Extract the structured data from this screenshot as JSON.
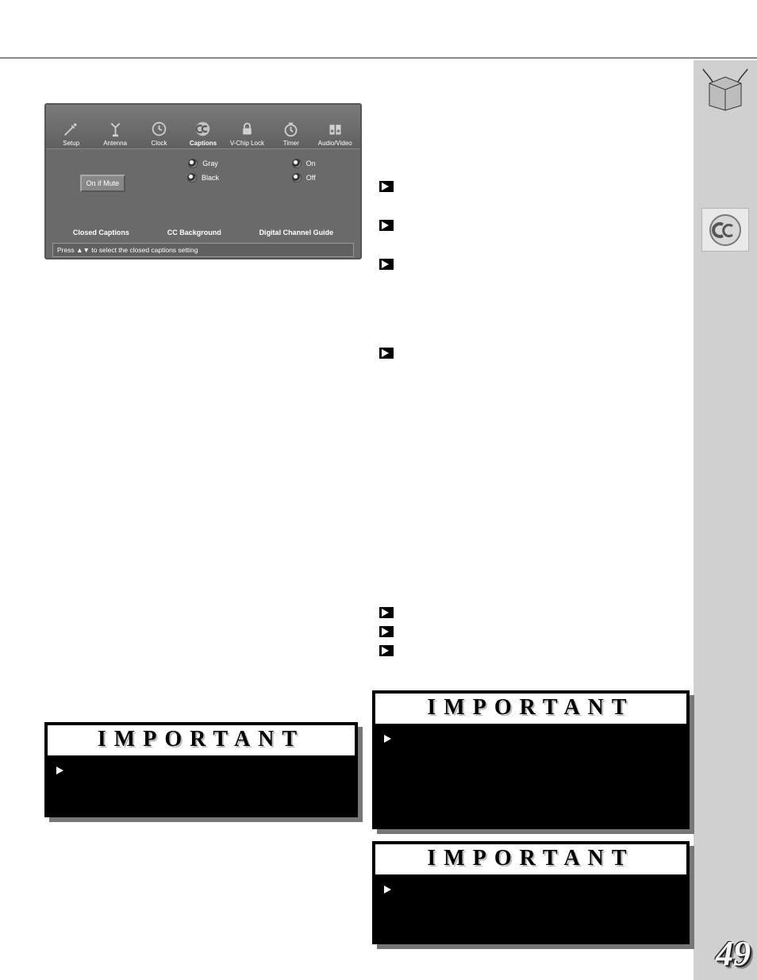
{
  "page_number": "49",
  "osd": {
    "tabs": [
      {
        "label": "Setup",
        "icon": "wand"
      },
      {
        "label": "Antenna",
        "icon": "antenna"
      },
      {
        "label": "Clock",
        "icon": "clock"
      },
      {
        "label": "Captions",
        "icon": "cc",
        "active": true
      },
      {
        "label": "V-Chip Lock",
        "icon": "lock"
      },
      {
        "label": "Timer",
        "icon": "timer"
      },
      {
        "label": "Audio/Video",
        "icon": "speakers"
      }
    ],
    "columns": {
      "closed_captions": {
        "label": "Closed Captions",
        "button": "On if Mute"
      },
      "cc_background": {
        "label": "CC Background",
        "opts": [
          "Gray",
          "Black"
        ]
      },
      "digital_channel_guide": {
        "label": "Digital Channel Guide",
        "opts": [
          "On",
          "Off"
        ]
      }
    },
    "hint": "Press ▲▼ to select the closed captions setting"
  },
  "important": {
    "header": "IMPORTANT",
    "box_a": " ",
    "box_b": " ",
    "box_c": " "
  },
  "sidebar": {
    "cc_icon_label": "cc-stamp",
    "corner_icon_label": "box-with-antennae"
  }
}
